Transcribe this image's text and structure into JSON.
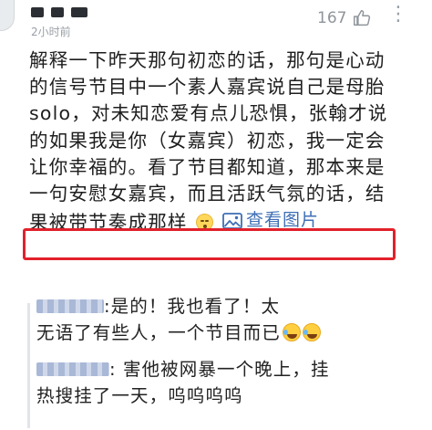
{
  "comment": {
    "time": "2小时前",
    "like_count": "167",
    "body_lines": [
      "解释一下昨天那句初恋的话，那句是心动",
      "的信号节目中一个素人嘉宾说自己是母胎",
      "solo，对未知恋爱有点儿恐惧，张翰才说",
      "的如果我是你（女嘉宾）初恋，我一定会",
      "让你幸福的。看了节目都知道，那本来是",
      "一句安慰女嘉宾，而且活跃气氛的话，结"
    ],
    "last_line_text": "果被带节奏成那样",
    "last_line_emoji": "faint-emoji",
    "view_image_label": "查看图片",
    "highlight_color": "#e2212b",
    "link_color": "#3f6fb5"
  },
  "replies": [
    {
      "lines": [
        ":是的！我也看了！太",
        "无语了有些人，一个节目而已"
      ],
      "emojis": [
        "laughing-tears-emoji",
        "laughing-tears-emoji"
      ]
    },
    {
      "lines": [
        ": 害他被网暴一个晚上，挂",
        "热搜挂了一天，呜呜呜呜"
      ]
    }
  ]
}
